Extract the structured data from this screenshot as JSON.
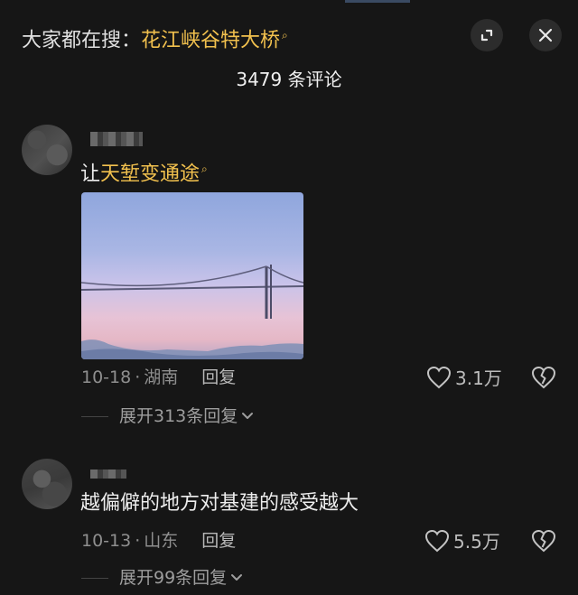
{
  "header": {
    "search_prefix": "大家都在搜：",
    "search_term": "花江峡谷特大桥",
    "collapse_icon": "collapse-icon",
    "close_icon": "close-icon"
  },
  "comment_count": "3479 条评论",
  "comments": [
    {
      "text_prefix": "让",
      "text_highlight": "天堑变通途",
      "date": "10-18",
      "location": "湖南",
      "reply_label": "回复",
      "likes": "3.1万",
      "expand_label": "展开313条回复"
    },
    {
      "text": "越偏僻的地方对基建的感受越大",
      "date": "10-13",
      "location": "山东",
      "reply_label": "回复",
      "likes": "5.5万",
      "expand_label": "展开99条回复"
    }
  ],
  "colors": {
    "background": "#161616",
    "highlight": "#f2c14e",
    "muted": "#8f8f8f"
  }
}
